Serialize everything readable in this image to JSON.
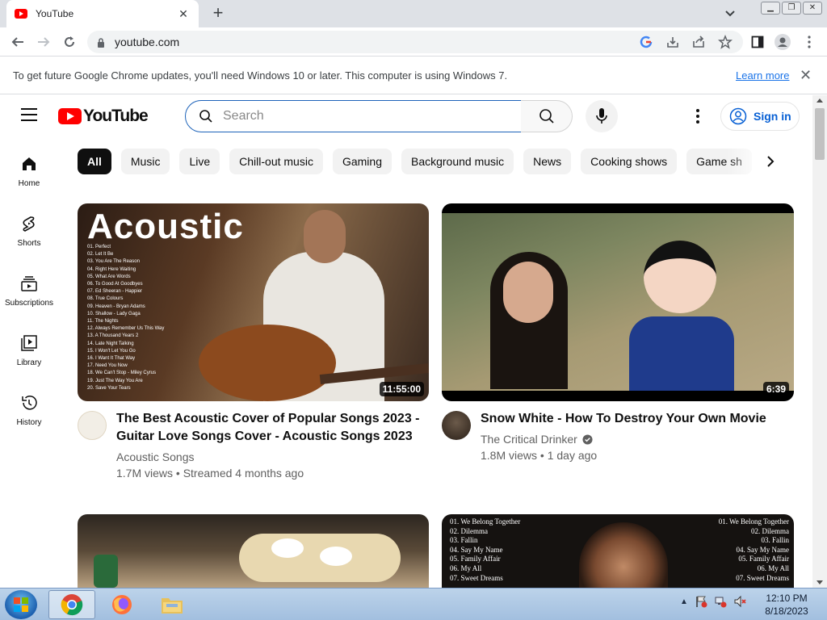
{
  "browser": {
    "tab_title": "YouTube",
    "new_tab": "+",
    "url": "youtube.com"
  },
  "infobar": {
    "message": "To get future Google Chrome updates, you'll need Windows 10 or later. This computer is using Windows 7.",
    "learn_more": "Learn more"
  },
  "youtube": {
    "logo_text": "YouTube",
    "search_placeholder": "Search",
    "sign_in": "Sign in",
    "sidebar": [
      {
        "label": "Home",
        "icon": "home-icon"
      },
      {
        "label": "Shorts",
        "icon": "shorts-icon"
      },
      {
        "label": "Subscriptions",
        "icon": "subscriptions-icon"
      },
      {
        "label": "Library",
        "icon": "library-icon"
      },
      {
        "label": "History",
        "icon": "history-icon"
      }
    ],
    "chips": [
      "All",
      "Music",
      "Live",
      "Chill-out music",
      "Gaming",
      "Background music",
      "News",
      "Cooking shows",
      "Game sh"
    ],
    "videos": [
      {
        "title_line1": "The Best Acoustic Cover of Popular Songs 2023 -",
        "title_line2": "Guitar Love Songs Cover - Acoustic Songs 2023",
        "channel": "Acoustic Songs",
        "stats": "1.7M views • Streamed 4 months ago",
        "duration": "11:55:00",
        "thumb_heading": "Acoustic",
        "tracklist": [
          "01. Perfect",
          "02. Let It Be",
          "03. You Are The Reason",
          "04. Right Here Waiting",
          "05. What Are Words",
          "06. To Good At Goodbyes",
          "07. Ed Sheeran - Happier",
          "08. True Colours",
          "09. Heaven - Bryan Adams",
          "10. Shallow - Lady Gaga",
          "11. The Nights",
          "12. Always Remember Us This Way",
          "13. A Thousand Years 2",
          "14. Late Night Talking",
          "15. I Won't Let You Go",
          "16. I Want It That Way",
          "17. Need You Now",
          "18. We Can't Stop - Miley Cyrus",
          "19. Just The Way You Are",
          "20. Save Your Tears"
        ]
      },
      {
        "title_line1": "Snow White - How To Destroy Your Own Movie",
        "title_line2": "",
        "channel": "The Critical Drinker",
        "stats": "1.8M views • 1 day ago",
        "duration": "6:39",
        "verified": true
      }
    ],
    "row2_tracklist_left": [
      "01. We Belong Together",
      "02. Dilemma",
      "03. Fallin",
      "04. Say My Name",
      "05. Family Affair",
      "06. My All",
      "07. Sweet Dreams"
    ],
    "row2_tracklist_right": [
      "01. We Belong Together",
      "02. Dilemma",
      "03. Fallin",
      "04. Say My Name",
      "05. Family Affair",
      "06. My All",
      "07. Sweet Dreams"
    ]
  },
  "taskbar": {
    "time": "12:10 PM",
    "date": "8/18/2023"
  },
  "colors": {
    "youtube_red": "#ff0000",
    "link_blue": "#065fd4",
    "search_focus": "#1c62b9"
  }
}
